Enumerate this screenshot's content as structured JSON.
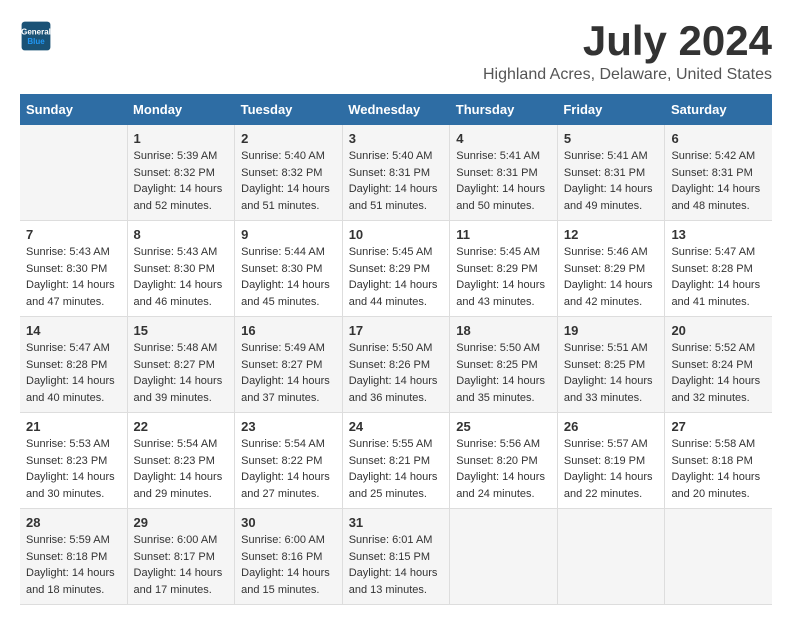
{
  "header": {
    "logo_line1": "General",
    "logo_line2": "Blue",
    "month_year": "July 2024",
    "location": "Highland Acres, Delaware, United States"
  },
  "calendar": {
    "columns": [
      "Sunday",
      "Monday",
      "Tuesday",
      "Wednesday",
      "Thursday",
      "Friday",
      "Saturday"
    ],
    "rows": [
      [
        {
          "day": "",
          "info": ""
        },
        {
          "day": "1",
          "info": "Sunrise: 5:39 AM\nSunset: 8:32 PM\nDaylight: 14 hours\nand 52 minutes."
        },
        {
          "day": "2",
          "info": "Sunrise: 5:40 AM\nSunset: 8:32 PM\nDaylight: 14 hours\nand 51 minutes."
        },
        {
          "day": "3",
          "info": "Sunrise: 5:40 AM\nSunset: 8:31 PM\nDaylight: 14 hours\nand 51 minutes."
        },
        {
          "day": "4",
          "info": "Sunrise: 5:41 AM\nSunset: 8:31 PM\nDaylight: 14 hours\nand 50 minutes."
        },
        {
          "day": "5",
          "info": "Sunrise: 5:41 AM\nSunset: 8:31 PM\nDaylight: 14 hours\nand 49 minutes."
        },
        {
          "day": "6",
          "info": "Sunrise: 5:42 AM\nSunset: 8:31 PM\nDaylight: 14 hours\nand 48 minutes."
        }
      ],
      [
        {
          "day": "7",
          "info": "Sunrise: 5:43 AM\nSunset: 8:30 PM\nDaylight: 14 hours\nand 47 minutes."
        },
        {
          "day": "8",
          "info": "Sunrise: 5:43 AM\nSunset: 8:30 PM\nDaylight: 14 hours\nand 46 minutes."
        },
        {
          "day": "9",
          "info": "Sunrise: 5:44 AM\nSunset: 8:30 PM\nDaylight: 14 hours\nand 45 minutes."
        },
        {
          "day": "10",
          "info": "Sunrise: 5:45 AM\nSunset: 8:29 PM\nDaylight: 14 hours\nand 44 minutes."
        },
        {
          "day": "11",
          "info": "Sunrise: 5:45 AM\nSunset: 8:29 PM\nDaylight: 14 hours\nand 43 minutes."
        },
        {
          "day": "12",
          "info": "Sunrise: 5:46 AM\nSunset: 8:29 PM\nDaylight: 14 hours\nand 42 minutes."
        },
        {
          "day": "13",
          "info": "Sunrise: 5:47 AM\nSunset: 8:28 PM\nDaylight: 14 hours\nand 41 minutes."
        }
      ],
      [
        {
          "day": "14",
          "info": "Sunrise: 5:47 AM\nSunset: 8:28 PM\nDaylight: 14 hours\nand 40 minutes."
        },
        {
          "day": "15",
          "info": "Sunrise: 5:48 AM\nSunset: 8:27 PM\nDaylight: 14 hours\nand 39 minutes."
        },
        {
          "day": "16",
          "info": "Sunrise: 5:49 AM\nSunset: 8:27 PM\nDaylight: 14 hours\nand 37 minutes."
        },
        {
          "day": "17",
          "info": "Sunrise: 5:50 AM\nSunset: 8:26 PM\nDaylight: 14 hours\nand 36 minutes."
        },
        {
          "day": "18",
          "info": "Sunrise: 5:50 AM\nSunset: 8:25 PM\nDaylight: 14 hours\nand 35 minutes."
        },
        {
          "day": "19",
          "info": "Sunrise: 5:51 AM\nSunset: 8:25 PM\nDaylight: 14 hours\nand 33 minutes."
        },
        {
          "day": "20",
          "info": "Sunrise: 5:52 AM\nSunset: 8:24 PM\nDaylight: 14 hours\nand 32 minutes."
        }
      ],
      [
        {
          "day": "21",
          "info": "Sunrise: 5:53 AM\nSunset: 8:23 PM\nDaylight: 14 hours\nand 30 minutes."
        },
        {
          "day": "22",
          "info": "Sunrise: 5:54 AM\nSunset: 8:23 PM\nDaylight: 14 hours\nand 29 minutes."
        },
        {
          "day": "23",
          "info": "Sunrise: 5:54 AM\nSunset: 8:22 PM\nDaylight: 14 hours\nand 27 minutes."
        },
        {
          "day": "24",
          "info": "Sunrise: 5:55 AM\nSunset: 8:21 PM\nDaylight: 14 hours\nand 25 minutes."
        },
        {
          "day": "25",
          "info": "Sunrise: 5:56 AM\nSunset: 8:20 PM\nDaylight: 14 hours\nand 24 minutes."
        },
        {
          "day": "26",
          "info": "Sunrise: 5:57 AM\nSunset: 8:19 PM\nDaylight: 14 hours\nand 22 minutes."
        },
        {
          "day": "27",
          "info": "Sunrise: 5:58 AM\nSunset: 8:18 PM\nDaylight: 14 hours\nand 20 minutes."
        }
      ],
      [
        {
          "day": "28",
          "info": "Sunrise: 5:59 AM\nSunset: 8:18 PM\nDaylight: 14 hours\nand 18 minutes."
        },
        {
          "day": "29",
          "info": "Sunrise: 6:00 AM\nSunset: 8:17 PM\nDaylight: 14 hours\nand 17 minutes."
        },
        {
          "day": "30",
          "info": "Sunrise: 6:00 AM\nSunset: 8:16 PM\nDaylight: 14 hours\nand 15 minutes."
        },
        {
          "day": "31",
          "info": "Sunrise: 6:01 AM\nSunset: 8:15 PM\nDaylight: 14 hours\nand 13 minutes."
        },
        {
          "day": "",
          "info": ""
        },
        {
          "day": "",
          "info": ""
        },
        {
          "day": "",
          "info": ""
        }
      ]
    ]
  }
}
